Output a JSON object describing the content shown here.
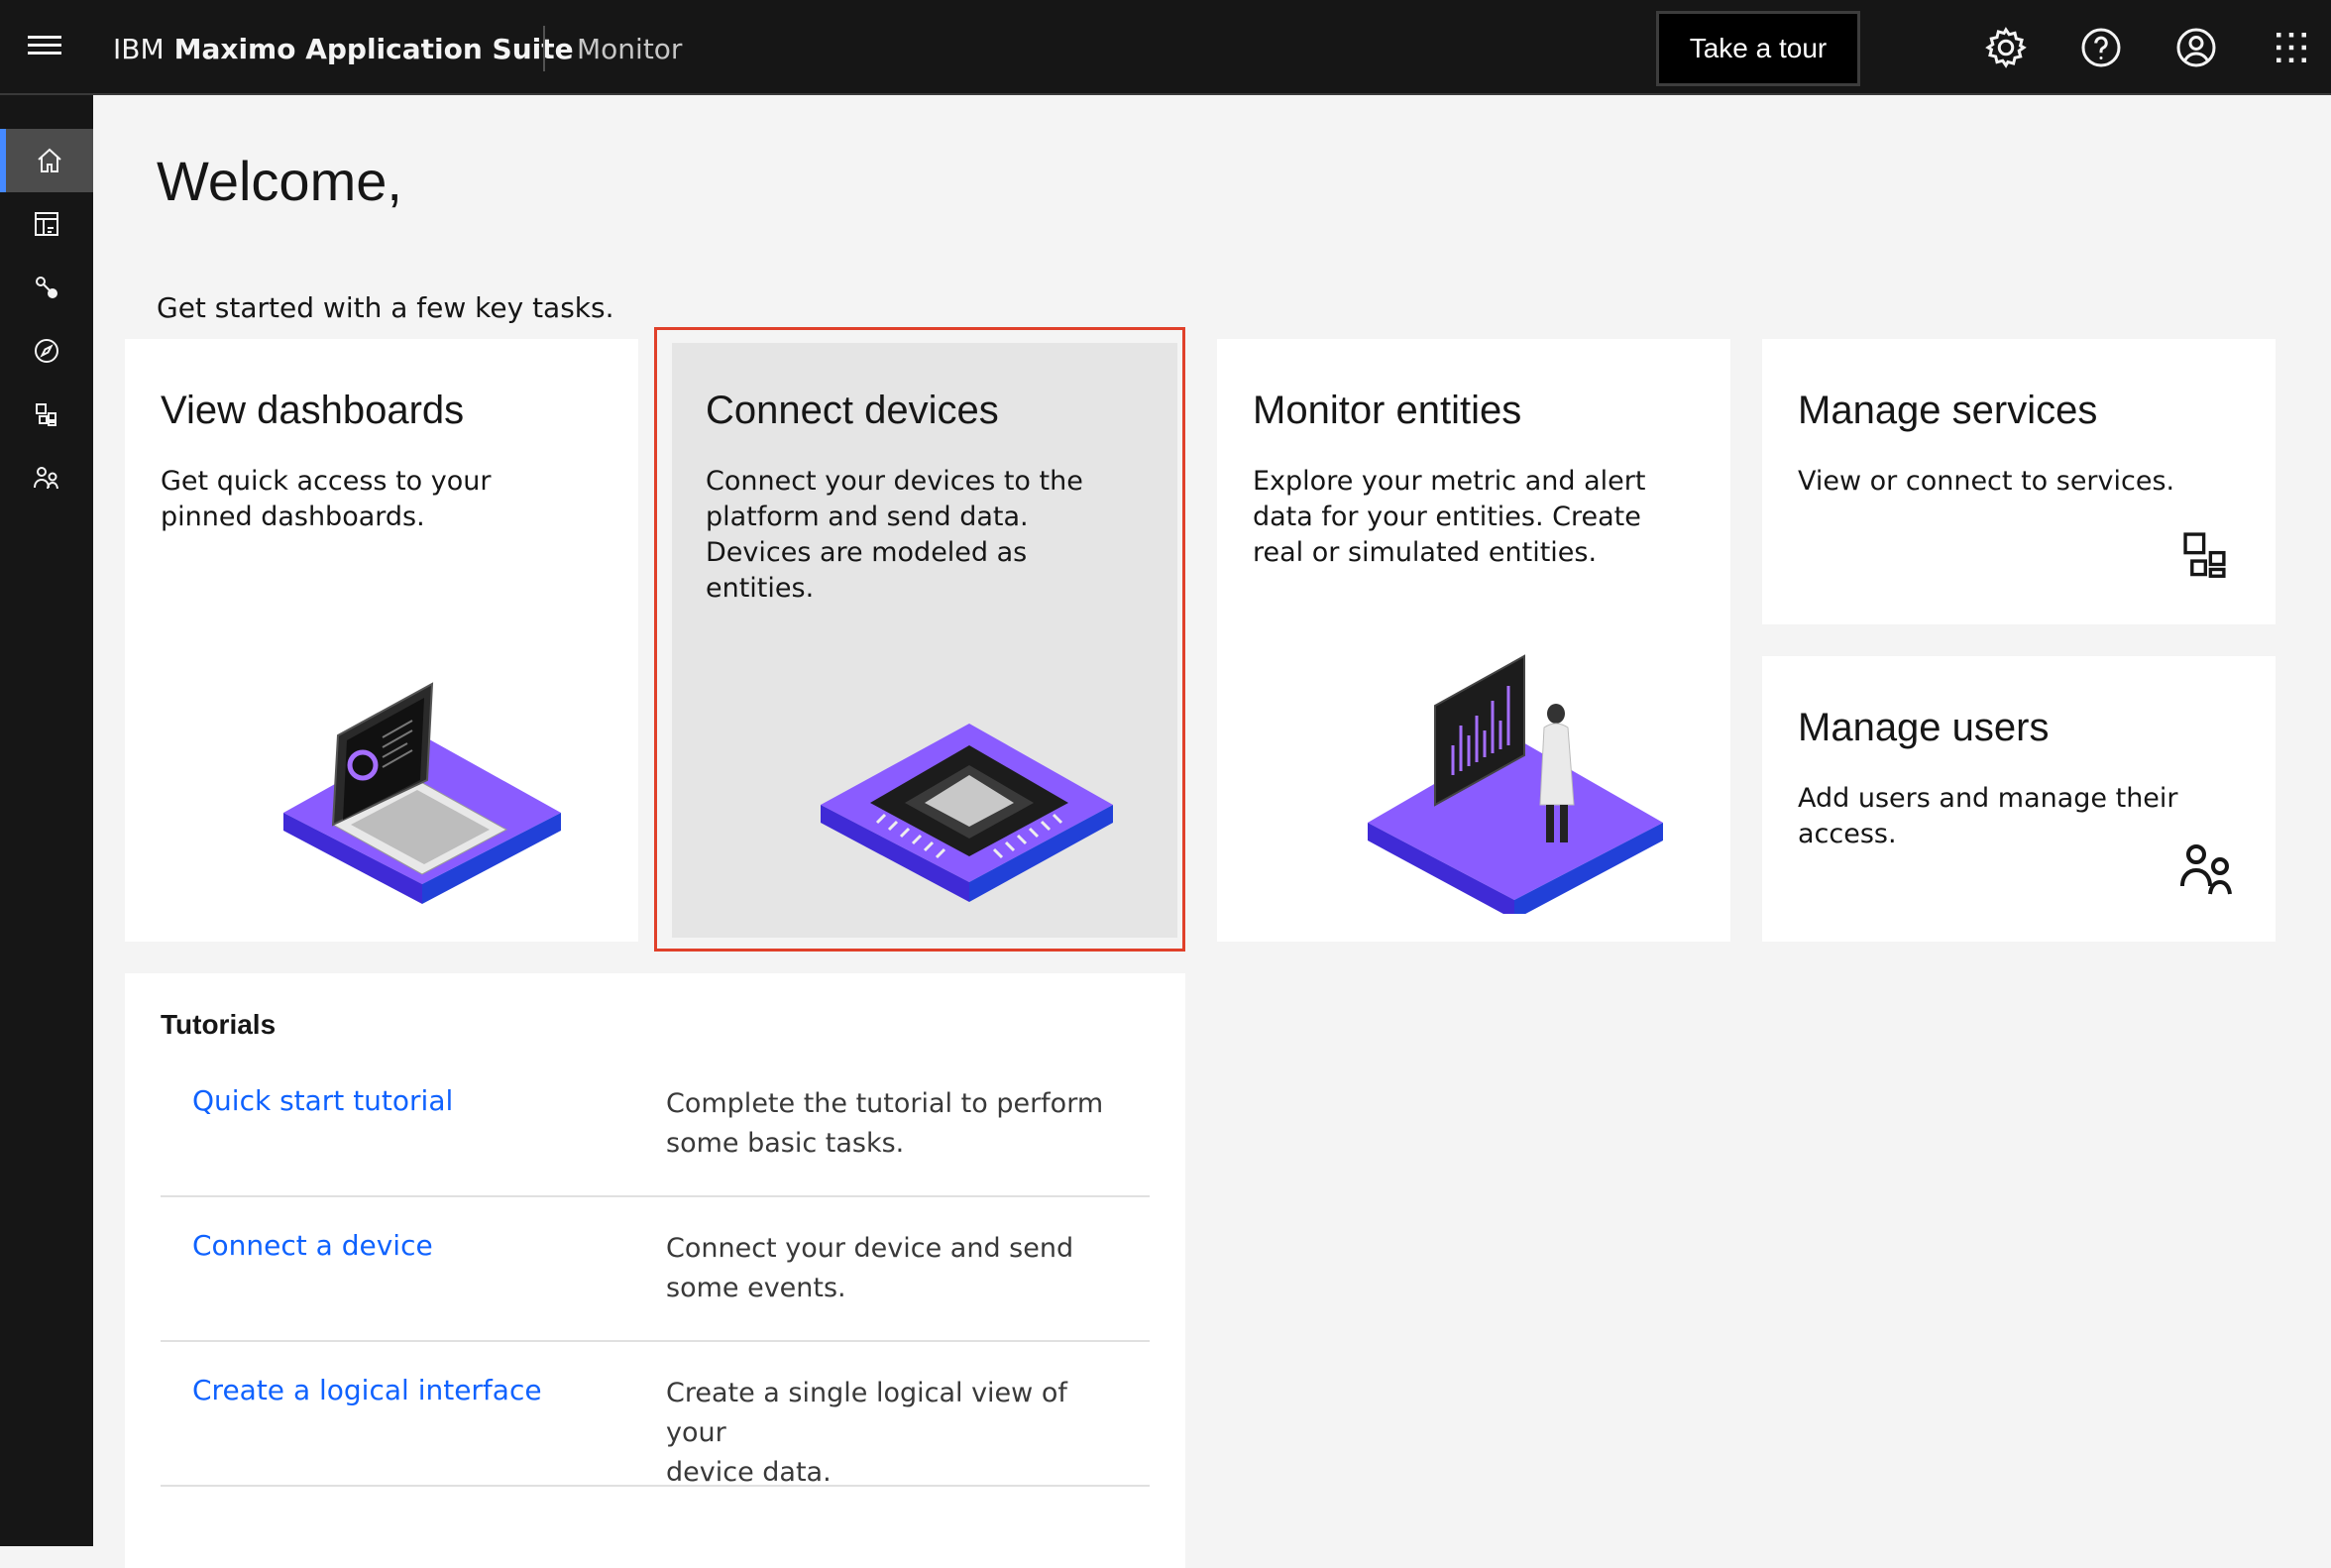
{
  "header": {
    "brand_prefix": "IBM",
    "brand_name": "Maximo Application Suite",
    "app_name": "Monitor",
    "tour_button": "Take a tour",
    "icons": [
      "menu-icon",
      "settings-icon",
      "help-icon",
      "user-avatar-icon",
      "app-switcher-icon"
    ]
  },
  "sidenav": {
    "items": [
      {
        "name": "home",
        "icon": "home-icon",
        "active": true
      },
      {
        "name": "dashboards",
        "icon": "dashboard-icon"
      },
      {
        "name": "setup",
        "icon": "connect-icon"
      },
      {
        "name": "explore",
        "icon": "compass-icon"
      },
      {
        "name": "services",
        "icon": "apps-icon"
      },
      {
        "name": "users",
        "icon": "users-icon"
      }
    ]
  },
  "main": {
    "welcome": "Welcome,",
    "subtitle": "Get started with a few key tasks.",
    "cards": [
      {
        "title": "View dashboards",
        "desc_lines": [
          "Get quick access to your",
          "pinned dashboards."
        ]
      },
      {
        "title": "Connect devices",
        "desc_lines": [
          "Connect your devices to the",
          "platform and send data.",
          "Devices are modeled as",
          "entities."
        ],
        "highlighted": true
      },
      {
        "title": "Monitor entities",
        "desc_lines": [
          "Explore your metric and alert",
          "data for your entities. Create",
          "real or simulated entities."
        ]
      },
      {
        "title": "Manage services",
        "desc_lines": [
          "View or connect to services."
        ]
      },
      {
        "title": "Manage users",
        "desc_lines": [
          "Add users and manage their",
          "access."
        ]
      }
    ]
  },
  "tutorials": {
    "heading": "Tutorials",
    "rows": [
      {
        "link": "Quick start tutorial",
        "desc_lines": [
          "Complete the tutorial to perform",
          "some basic tasks."
        ]
      },
      {
        "link": "Connect a device",
        "desc_lines": [
          "Connect your device and send",
          "some events."
        ]
      },
      {
        "link": "Create a logical interface",
        "desc_lines": [
          "Create a single logical view of your",
          "device data."
        ]
      }
    ]
  },
  "colors": {
    "header_bg": "#161616",
    "accent_link": "#0f62fe",
    "active_nav_indicator": "#4589ff",
    "highlight_border": "#e0402a",
    "illustration_purple": "#a56eff",
    "illustration_blue": "#4a3aff"
  }
}
